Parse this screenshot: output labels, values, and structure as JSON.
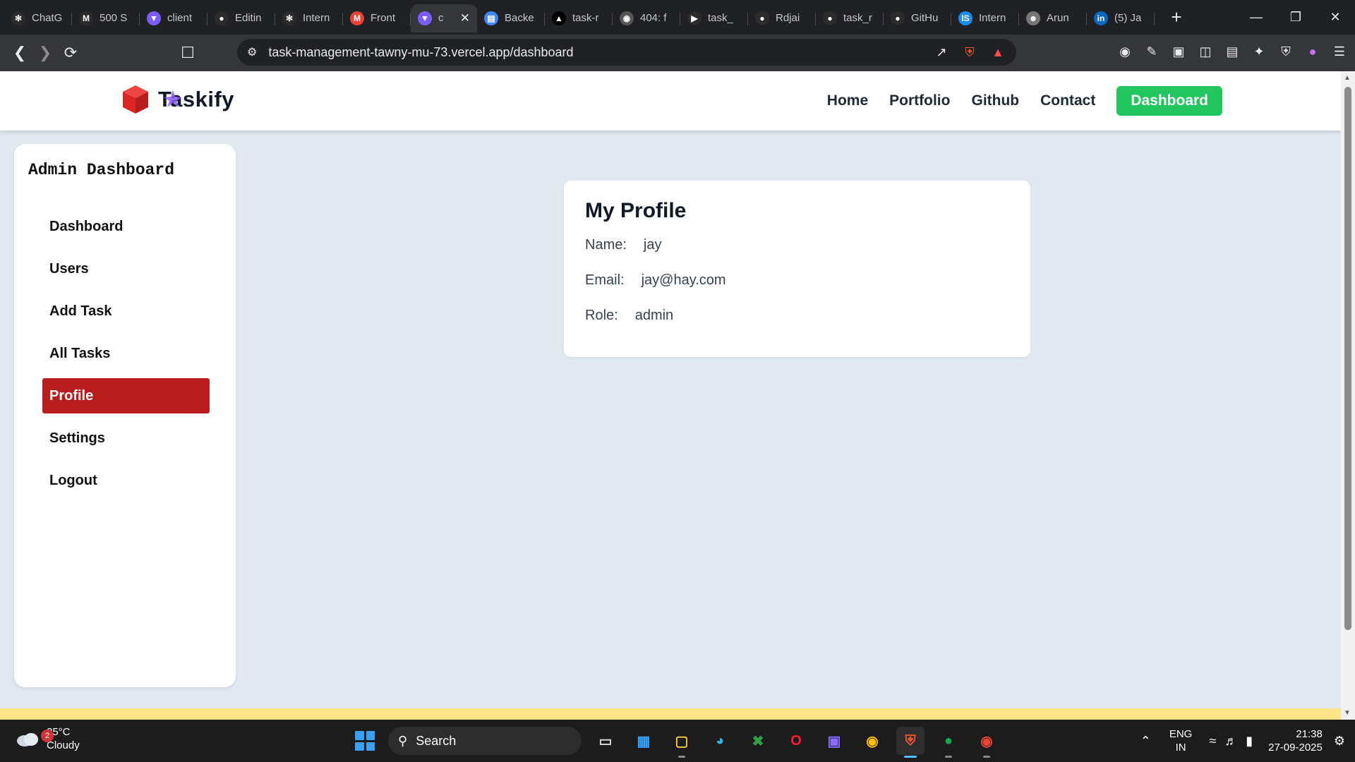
{
  "browser": {
    "tabs": [
      {
        "label": "ChatG",
        "icon": "openai-icon",
        "color": "#2b2b2b"
      },
      {
        "label": "500 S",
        "icon": "medium-icon",
        "color": "#2b2b2b"
      },
      {
        "label": "client",
        "icon": "vite-icon",
        "color": "#7b5cff"
      },
      {
        "label": "Editin",
        "icon": "github-icon",
        "color": "#2b2b2b"
      },
      {
        "label": "Intern",
        "icon": "openai-icon",
        "color": "#2b2b2b"
      },
      {
        "label": "Front",
        "icon": "gmail-icon",
        "color": "#ea4335"
      },
      {
        "label": "c",
        "icon": "vite-icon",
        "color": "#7b5cff",
        "active": true
      },
      {
        "label": "Backe",
        "icon": "docs-icon",
        "color": "#4285f4"
      },
      {
        "label": "task-r",
        "icon": "vercel-icon",
        "color": "#000000"
      },
      {
        "label": "404: f",
        "icon": "globe-icon",
        "color": "#555555"
      },
      {
        "label": "task_",
        "icon": "render-icon",
        "color": "#2b2b2b"
      },
      {
        "label": "Rdjai",
        "icon": "github-icon",
        "color": "#2b2b2b"
      },
      {
        "label": "task_r",
        "icon": "github-icon",
        "color": "#2b2b2b"
      },
      {
        "label": "GitHu",
        "icon": "github-icon",
        "color": "#2b2b2b"
      },
      {
        "label": "Intern",
        "icon": "internshala-icon",
        "color": "#1a8cf0"
      },
      {
        "label": "Arun",
        "icon": "avatar-icon",
        "color": "#777777"
      },
      {
        "label": "(5) Ja",
        "icon": "linkedin-icon",
        "color": "#0a66c2"
      }
    ],
    "url": "task-management-tawny-mu-73.vercel.app/dashboard"
  },
  "site": {
    "logo_text": "Taskify",
    "nav": [
      "Home",
      "Portfolio",
      "Github",
      "Contact"
    ],
    "dashboard_button": "Dashboard",
    "brand_red": "#dc2626",
    "brand_green": "#22c55e"
  },
  "sidebar": {
    "title": "Admin Dashboard",
    "items": [
      {
        "label": "Dashboard"
      },
      {
        "label": "Users"
      },
      {
        "label": "Add Task"
      },
      {
        "label": "All Tasks"
      },
      {
        "label": "Profile",
        "active": true
      },
      {
        "label": "Settings"
      },
      {
        "label": "Logout"
      }
    ],
    "active_color": "#b91c1c"
  },
  "profile": {
    "title": "My Profile",
    "name_label": "Name:",
    "name": "jay",
    "email_label": "Email:",
    "email": "jay@hay.com",
    "role_label": "Role:",
    "role": "admin"
  },
  "taskbar": {
    "weather_temp": "25°C",
    "weather_desc": "Cloudy",
    "weather_badge": "2",
    "search_label": "Search",
    "lang_1": "ENG",
    "lang_2": "IN",
    "time": "21:38",
    "date": "27-09-2025"
  }
}
